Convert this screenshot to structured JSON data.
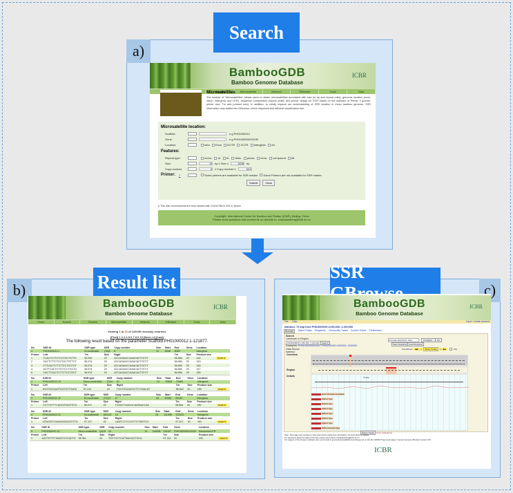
{
  "labels": {
    "search": "Search",
    "result_list": "Result list",
    "ssr_gbrowse": "SSR GBrowse"
  },
  "panel_tags": {
    "a": "a)",
    "b": "b)",
    "c": "c)"
  },
  "site": {
    "logo": "BambooGDB",
    "subtitle": "Bamboo Genome Database",
    "icbr": "ICBR",
    "nav": [
      "Home",
      "Search",
      "Browse",
      "Microsatellite",
      "Network",
      "GBrowse",
      "Tools",
      "Data"
    ]
  },
  "search_page": {
    "heading": "Microsatellites",
    "description": "The module of \"Microsatellites\" allows users to obtain microsatellites annotated with size (in bp and repeat units), genomic location (exon, intron, intergenic and UTR), sequence composition (repeat motif), and primer design for PCR based on the software of Primer 3 (primer, primer size, Tm and product size). In addition, to vividly expand our understanding of SSR location in moso bamboo genome, SSR information was added into GBrowse, which important and efficient visualization tool.",
    "location_title": "Microsatellite location:",
    "scaffold_label": "Scaffold:",
    "scaffold_hint": "e.g PH01000012",
    "gene_label": "Gene:",
    "gene_hint": "e.g PH01000000G0240",
    "location_label": "Location:",
    "location_options": [
      "Intro",
      "Exon",
      "5'UTR",
      "3'UTR",
      "Intergenic",
      "All"
    ],
    "features_title": "Features:",
    "repeat_type_label": "Repeat type:",
    "repeat_options": [
      "mono-",
      "di-",
      "tri-",
      "tetra-",
      "penta-",
      "hexa-",
      "compound",
      "All"
    ],
    "size_label": "Size:",
    "size_min": "10",
    "size_mid": "bp  ≤  Size  ≤",
    "size_max": "10/36",
    "size_unit": "bp",
    "copy_label": "Copy number:",
    "copy_min": "8",
    "copy_mid": "≤ Copy number ≤",
    "copy_max": "8/19",
    "primer_label": "Primer:",
    "primer_help": "?",
    "primer_opt1": "Some primers are available for SSR marker",
    "primer_opt2": "Some Primers are not available for SSR marker",
    "select_default": "---",
    "fill_btn": "Fill",
    "submit": "Submit",
    "clear": "Clear",
    "note": "# This site recommends the best viewed with 1024x768 in IE8 or above",
    "copyright": "Copyright: International Center for Bamboo and Rattan (ICBR), Beijing, China",
    "contact": "Please send questions and comments on website to: zhaohansheng@icbr.ac.cn"
  },
  "result_page": {
    "viewing_pre": "Viewing ",
    "viewing_from": "1",
    "viewing_to": "10",
    "viewing_post": " of 119195 record(s) returned.",
    "pager": "[First] 1 2 3 4 5 6 7 8 9 10 [Next >>] [Last]",
    "param_line": "The following result based on the parameter:Scaffold:PH01000012:1-121877.",
    "ssr_headers": [
      "No",
      "SSR ID",
      "SSR type",
      "SSR",
      "Copy number",
      "Size",
      "Start",
      "End",
      "Gene",
      "Location"
    ],
    "primer_headers": [
      "Primer",
      "Left",
      "Tm",
      "Size",
      "Right",
      "Tm",
      "Size",
      "Product size"
    ],
    "more_label": "more",
    "records": [
      {
        "ssr": [
          "1",
          "PH01000012.1",
          "Di-nucleotide",
          "(TA)6",
          "6",
          "12",
          "6048",
          "6059",
          "",
          "Intergenic"
        ],
        "primers": [
          [
            "1",
            "TCACTCTTCTCCTGCTGTTC",
            "56.992",
            "20",
            "ACCAGAACCAAACACTGTCT",
            "56.896",
            "20",
            "244"
          ],
          [
            "2",
            "CACTCTTCTCCTGCTGTTCT",
            "56.974",
            "20",
            "ACCAGAACCAAACACTGTCT",
            "56.896",
            "20",
            "243"
          ],
          [
            "3",
            "CTTCACTCTTCTCCTGCTGT",
            "56.974",
            "20",
            "ACCAGAACCAAACACTGTCT",
            "56.896",
            "20",
            "246"
          ],
          [
            "4",
            "ACTTCACTCTTCTCCTGCTG",
            "56.974",
            "20",
            "ACCAGAACCAAACACTGTCT",
            "56.896",
            "20",
            "247"
          ],
          [
            "5",
            "CACTTCACTCTTCTCCTGCT",
            "56.974",
            "20",
            "ACCAGAACCAAACACTGTCT",
            "56.896",
            "20",
            "248"
          ]
        ]
      },
      {
        "ssr": [
          "2",
          "PH01000012.10",
          "Mono-nucleotide",
          "(T)10",
          "10",
          "10",
          "70654",
          "70663",
          "",
          "Intergenic"
        ],
        "primers": [
          [
            "1",
            "ATGTGGCAGTGGTGTTGATA",
            "57.123",
            "20",
            "TGCTGGGATGCTTCTAACAT",
            "56.902",
            "20",
            "183"
          ]
        ]
      },
      {
        "ssr": [
          "3",
          "PH01000012.11",
          "Di-nucleotide",
          "(TC)27",
          "27",
          "54",
          "83381",
          "83434",
          "",
          "Intergenic"
        ],
        "primers": [
          [
            "1",
            "CCTTGTTTCAGGGTAGTGTG",
            "56.973",
            "20",
            "TCGACTGAGGCAATAACCAA",
            "56.859",
            "20",
            "190"
          ]
        ]
      },
      {
        "ssr": [
          "4",
          "PH01000012.12",
          "Di-nucleotide",
          "(AG)13",
          "13",
          "26",
          "111998",
          "112023",
          "",
          "Intergenic"
        ],
        "primers": [
          [
            "1",
            "GTAGGTCGAGAGGGATGTTG",
            "57.127",
            "20",
            "CAATCCTCCCGTTCTAGTCC",
            "57.107",
            "20",
            "161"
          ]
        ]
      },
      {
        "ssr": [
          "5",
          "PH01000012.13",
          "Mono-nucleotide",
          "(A)10",
          "10",
          "10",
          "119098",
          "119107",
          "PH01000000G0240",
          "threeprimeUTR"
        ],
        "primers": [
          [
            "1",
            "AGCTGTTCTAAGTCCCACTG",
            "56.961",
            "20",
            "TGCTCCTCATTAACACTGCA",
            "57.143",
            "20",
            "242"
          ]
        ]
      }
    ]
  },
  "gbrowse_page": {
    "menu": [
      "File",
      "Help"
    ],
    "login": "Log in / create account",
    "title": "bamboo: 70 kbp from PH01000000:1,030,000..1,100,000",
    "tabs": [
      "Browser",
      "Select Tracks",
      "Snapshots",
      "Community Tracks",
      "Custom Tracks",
      "Preferences"
    ],
    "search_label": "Search",
    "landmark_label": "Landmark or Region:",
    "landmark_value": "PH01000000:1,030,000..1,100,000",
    "search_btn": "Search",
    "examples_label": "Examples:",
    "examples": "PH01000000G0240, PH01000000:1000000..1100000",
    "data_source_label": "Data Source",
    "data_source": "bamboo",
    "annotate_select": "Annotate Restriction Sites",
    "configure_btn": "Configure...",
    "go_btn": "Go",
    "save_snapshot": "Save Snapshot",
    "load_snapshot": "Load Snapshot",
    "scroll_zoom": "Scroll/Zoom:",
    "zoom_value": "Show 70 kbp",
    "flip": "Flip",
    "overview_label": "Overview",
    "region_label": "Region",
    "details_label": "Details",
    "scale_label": "70 kbp",
    "tracks": [
      "Gene Structure Annotation",
      "SSR of Type",
      "SSR of Type",
      "SSR of Type",
      "SSR of Type",
      "SSR of Type",
      "SSR of Type",
      "SSR compound Type"
    ],
    "select_tracks_btn": "Select Tracks",
    "clear_highlighting": "Clear highlighting",
    "note1": "Note: This page uses cookies to save and restore preference information. No information is shared.",
    "note2": "For questions about the data of this site, please send mail to zhaohansheng@icbr.ac.cn",
    "note3": "For support of the browser software only, send email to gmod-gbrowse@lists.sourceforge.net or visit the GMOD Project web pages. Generic Genome Browser version 2.54",
    "footer_logo": "ICBR"
  },
  "colors": {
    "label_blue": "#1f7ee8",
    "panel_bg": "#d5e6f8",
    "nav_green": "#9cc56c",
    "highlight_green": "#b7dc92",
    "more_yellow": "#ffea4a",
    "red": "#e02020"
  }
}
